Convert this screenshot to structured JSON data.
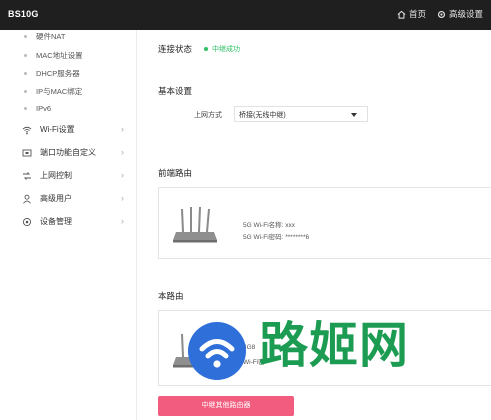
{
  "header": {
    "brand": "BS10G",
    "home_label": "首页",
    "advanced_label": "高级设置"
  },
  "sidebar": {
    "sub_items": [
      "硬件NAT",
      "MAC地址设置",
      "DHCP服务器",
      "IP与MAC绑定",
      "IPv6"
    ],
    "nav_items": [
      {
        "label": "Wi-Fi设置",
        "icon": "wifi-icon"
      },
      {
        "label": "端口功能自定义",
        "icon": "port-icon"
      },
      {
        "label": "上网控制",
        "icon": "control-icon"
      },
      {
        "label": "高级用户",
        "icon": "user-icon"
      },
      {
        "label": "设备管理",
        "icon": "gear-icon"
      }
    ]
  },
  "main": {
    "connection_label": "连接状态",
    "connection_status": "中继成功",
    "basic_title": "基本设置",
    "mode_label": "上网方式",
    "mode_value": "桥接(无线中继)",
    "front_title": "前端路由",
    "front_ssid": "5G Wi-Fi名称: xxx",
    "front_pwd": "5G Wi-Fi密码: ********6",
    "local_title": "本路由",
    "local_ssid": "4G8",
    "local_pwd": "Wi-Fi密",
    "relay_button": "中继其他路由器"
  },
  "watermark": {
    "text": "路姬网"
  },
  "colors": {
    "topbar": "#1f1f1f",
    "accent_pink": "#f25c7e",
    "success_green": "#2ec265",
    "watermark_blue": "#2e6fd9",
    "watermark_green": "#1c9b53"
  }
}
